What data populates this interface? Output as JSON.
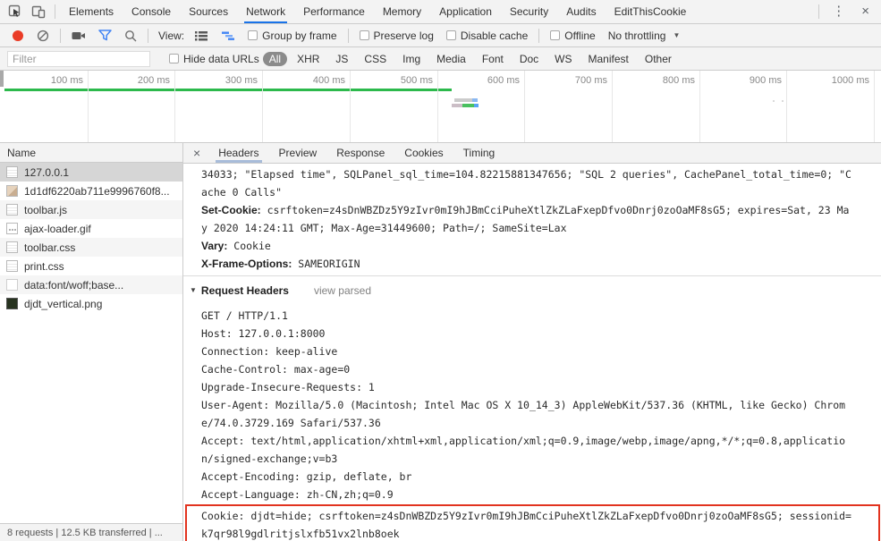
{
  "devtools": {
    "tabs": [
      "Elements",
      "Console",
      "Sources",
      "Network",
      "Performance",
      "Memory",
      "Application",
      "Security",
      "Audits",
      "EditThisCookie"
    ],
    "active_tab": "Network",
    "more_glyph": "⋮",
    "close_glyph": "×"
  },
  "toolbar": {
    "view_label": "View:",
    "checkboxes": [
      "Group by frame",
      "Preserve log",
      "Disable cache",
      "Offline"
    ],
    "throttling": "No throttling",
    "throttling_arrow": "▼"
  },
  "filter_bar": {
    "placeholder": "Filter",
    "hide_data_urls": "Hide data URLs",
    "types": [
      "All",
      "XHR",
      "JS",
      "CSS",
      "Img",
      "Media",
      "Font",
      "Doc",
      "WS",
      "Manifest",
      "Other"
    ],
    "active_type": "All"
  },
  "overview": {
    "ticks": [
      "100 ms",
      "200 ms",
      "300 ms",
      "400 ms",
      "500 ms",
      "600 ms",
      "700 ms",
      "800 ms",
      "900 ms",
      "1000 ms"
    ]
  },
  "requests": {
    "header": "Name",
    "rows": [
      {
        "name": "127.0.0.1",
        "icon": "document",
        "selected": true
      },
      {
        "name": "1d1df6220ab711e9996760f8...",
        "icon": "image"
      },
      {
        "name": "toolbar.js",
        "icon": "document"
      },
      {
        "name": "ajax-loader.gif",
        "icon": "image-dots"
      },
      {
        "name": "toolbar.css",
        "icon": "document"
      },
      {
        "name": "print.css",
        "icon": "document"
      },
      {
        "name": "data:font/woff;base...",
        "icon": "blank"
      },
      {
        "name": "djdt_vertical.png",
        "icon": "image-dark"
      }
    ]
  },
  "detail": {
    "close_glyph": "×",
    "tabs": [
      "Headers",
      "Preview",
      "Response",
      "Cookies",
      "Timing"
    ],
    "active_tab": "Headers"
  },
  "headers_view": {
    "response_lines": [
      {
        "t": "34033; \"Elapsed time\", SQLPanel_sql_time=104.82215881347656; \"SQL 2 queries\", CachePanel_total_time=0; \"C"
      },
      {
        "t": "ache 0 Calls\""
      },
      {
        "b": "Set-Cookie:",
        "t": " csrftoken=z4sDnWBZDz5Y9zIvr0mI9hJBmCciPuheXtlZkZLaFxepDfvo0Dnrj0zoOaMF8sG5; expires=Sat, 23 Ma"
      },
      {
        "t": "y 2020 14:24:11 GMT; Max-Age=31449600; Path=/; SameSite=Lax"
      },
      {
        "b": "Vary:",
        "t": " Cookie"
      },
      {
        "b": "X-Frame-Options:",
        "t": " SAMEORIGIN"
      }
    ],
    "request_section": {
      "arrow": "▼",
      "title": "Request Headers",
      "toggle": "view parsed"
    },
    "request_lines": [
      "GET / HTTP/1.1",
      "Host: 127.0.0.1:8000",
      "Connection: keep-alive",
      "Cache-Control: max-age=0",
      "Upgrade-Insecure-Requests: 1",
      "User-Agent: Mozilla/5.0 (Macintosh; Intel Mac OS X 10_14_3) AppleWebKit/537.36 (KHTML, like Gecko) Chrom",
      "e/74.0.3729.169 Safari/537.36",
      "Accept: text/html,application/xhtml+xml,application/xml;q=0.9,image/webp,image/apng,*/*;q=0.8,applicatio",
      "n/signed-exchange;v=b3",
      "Accept-Encoding: gzip, deflate, br",
      "Accept-Language: zh-CN,zh;q=0.9"
    ],
    "highlighted_lines": [
      "Cookie: djdt=hide; csrftoken=z4sDnWBZDz5Y9zIvr0mI9hJBmCciPuheXtlZkZLaFxepDfvo0Dnrj0zoOaMF8sG5; sessionid=",
      "k7qr98l9gdlritjslxfb51vx2lnb8oek"
    ]
  },
  "status_bar": {
    "summary": "8 requests | 12.5 KB transferred | ..."
  },
  "colors": {
    "accent_blue": "#1a73e8",
    "record_red": "#ea3b26",
    "funnel_blue": "#4285f4",
    "green_line": "#2cb94c",
    "highlight_red": "#e2331f",
    "selected_row": "#d6d6d6"
  }
}
